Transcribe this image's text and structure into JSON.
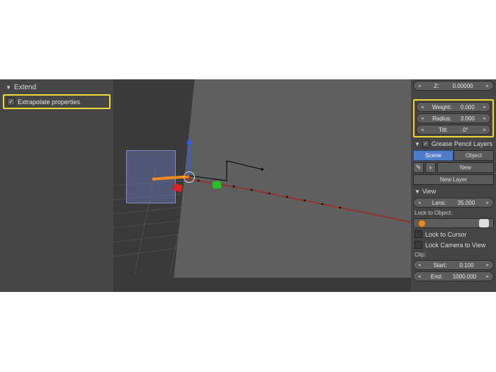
{
  "left_panel": {
    "header": "Extend",
    "option_label": "Extrapolate properties",
    "option_checked": true
  },
  "properties": {
    "z": {
      "label": "Z:",
      "value": "0.00000"
    },
    "weight": {
      "label": "Weight:",
      "value": "0.000"
    },
    "radius": {
      "label": "Radius:",
      "value": "3.000"
    },
    "tilt": {
      "label": "Tilt:",
      "value": "0°"
    }
  },
  "grease": {
    "header": "Grease Pencil Layers",
    "scene_btn": "Scene",
    "object_btn": "Object",
    "new_btn": "New",
    "new_layer_btn": "New Layer"
  },
  "view": {
    "header": "View",
    "lens": {
      "label": "Lens:",
      "value": "35.000"
    },
    "lock_to_object_label": "Lock to Object:",
    "lock_to_cursor_label": "Lock to Cursor",
    "lock_camera_label": "Lock Camera to View",
    "clip_label": "Clip:",
    "start": {
      "label": "Start:",
      "value": "0.100"
    },
    "end": {
      "label": "End:",
      "value": "1000.000"
    }
  },
  "icons": {
    "triangle": "▼",
    "check": "✓",
    "pencil": "✎",
    "plus": "+",
    "brush": "🖌"
  }
}
